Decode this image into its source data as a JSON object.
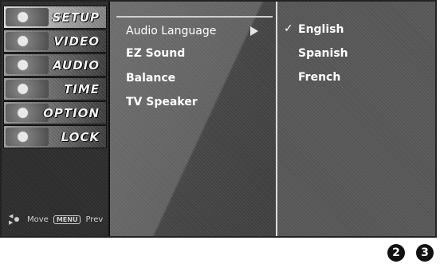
{
  "sidebar": {
    "items": [
      {
        "label": "SETUP",
        "icon": "setup-thumb-icon"
      },
      {
        "label": "VIDEO",
        "icon": "video-thumb-icon"
      },
      {
        "label": "AUDIO",
        "icon": "audio-thumb-icon"
      },
      {
        "label": "TIME",
        "icon": "time-thumb-icon"
      },
      {
        "label": "OPTION",
        "icon": "option-thumb-icon"
      },
      {
        "label": "LOCK",
        "icon": "lock-thumb-icon"
      }
    ],
    "help": {
      "move_label": "Move",
      "menu_key": "MENU",
      "prev_label": "Prev"
    }
  },
  "audio_menu": {
    "items": [
      "Audio Language",
      "EZ Sound",
      "Balance",
      "TV Speaker"
    ]
  },
  "language_options": {
    "selected": "English",
    "items": [
      "English",
      "Spanish",
      "French"
    ]
  },
  "step_badges": [
    "2",
    "3"
  ]
}
